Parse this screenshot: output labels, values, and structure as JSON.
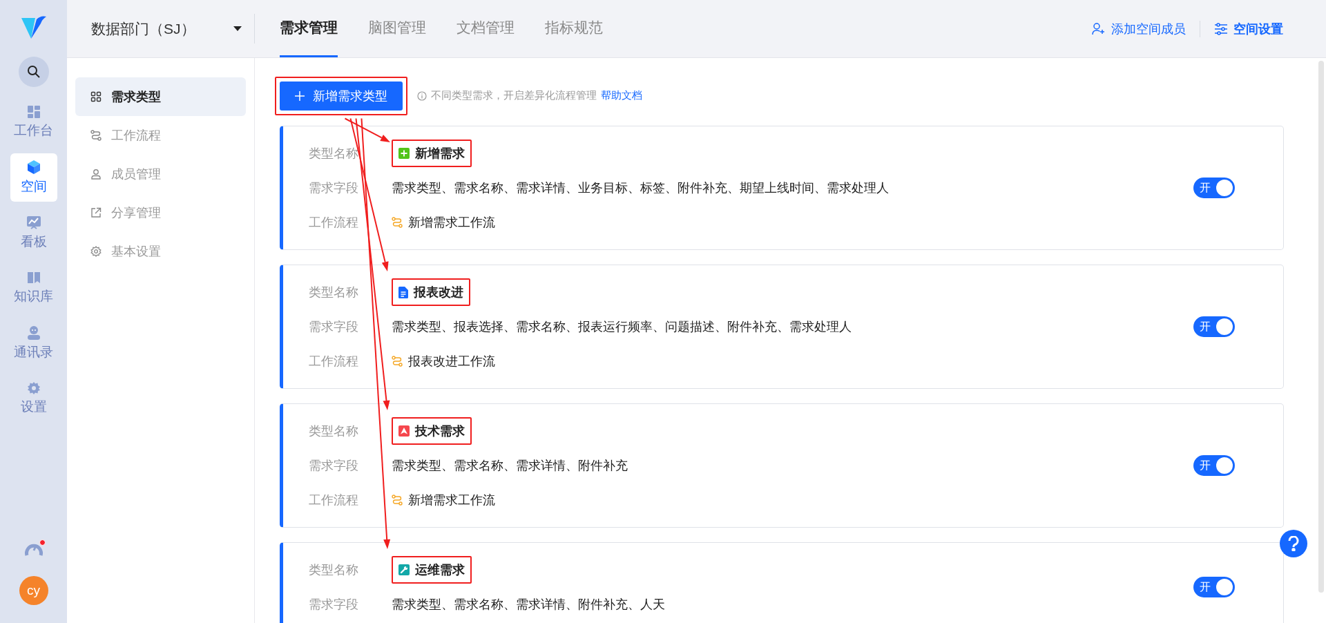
{
  "rail": {
    "items": [
      {
        "label": "工作台",
        "kind": "dashboard",
        "selected": false
      },
      {
        "label": "空间",
        "kind": "cube",
        "selected": true
      },
      {
        "label": "看板",
        "kind": "chart",
        "selected": false
      },
      {
        "label": "知识库",
        "kind": "book",
        "selected": false
      },
      {
        "label": "通讯录",
        "kind": "person",
        "selected": false
      },
      {
        "label": "设置",
        "kind": "gear",
        "selected": false
      }
    ],
    "notification": true,
    "avatar": "cy"
  },
  "org": {
    "name": "数据部门（SJ）"
  },
  "tabs": [
    {
      "label": "需求管理",
      "selected": true
    },
    {
      "label": "脑图管理",
      "selected": false
    },
    {
      "label": "文档管理",
      "selected": false
    },
    {
      "label": "指标规范",
      "selected": false
    }
  ],
  "actions": [
    {
      "label": "添加空间成员",
      "kind": "member"
    },
    {
      "label": "空间设置",
      "kind": "settings"
    }
  ],
  "sidebar": {
    "items": [
      {
        "label": "需求类型",
        "kind": "grid",
        "selected": true
      },
      {
        "label": "工作流程",
        "kind": "flow",
        "selected": false
      },
      {
        "label": "成员管理",
        "kind": "user",
        "selected": false
      },
      {
        "label": "分享管理",
        "kind": "share",
        "selected": false
      },
      {
        "label": "基本设置",
        "kind": "gear",
        "selected": false
      }
    ]
  },
  "toolbar": {
    "button": {
      "label": "新增需求类型",
      "highlighted": true
    },
    "hint": "不同类型需求，开启差异化流程管理",
    "help_link": "帮助文档"
  },
  "cards": [
    {
      "name_label": "类型名称",
      "name": "新增需求",
      "kind": "plus",
      "color": "#52c41a",
      "highlighted": true,
      "fields_label": "需求字段",
      "fields": "需求类型、需求名称、需求详情、业务目标、标签、附件补充、期望上线时间、需求处理人",
      "workflow_label": "工作流程",
      "workflow": "新增需求工作流",
      "on": true,
      "toggle_text": "开"
    },
    {
      "name_label": "类型名称",
      "name": "报表改进",
      "kind": "doc",
      "color": "#1668ff",
      "highlighted": true,
      "fields_label": "需求字段",
      "fields": "需求类型、报表选择、需求名称、报表运行频率、问题描述、附件补充、需求处理人",
      "workflow_label": "工作流程",
      "workflow": "报表改进工作流",
      "on": true,
      "toggle_text": "开"
    },
    {
      "name_label": "类型名称",
      "name": "技术需求",
      "kind": "alert",
      "color": "#f5474d",
      "highlighted": true,
      "fields_label": "需求字段",
      "fields": "需求类型、需求名称、需求详情、附件补充",
      "workflow_label": "工作流程",
      "workflow": "新增需求工作流",
      "on": true,
      "toggle_text": "开"
    },
    {
      "name_label": "类型名称",
      "name": "运维需求",
      "kind": "wrench",
      "color": "#13a8a8",
      "highlighted": true,
      "fields_label": "需求字段",
      "fields": "需求类型、需求名称、需求详情、附件补充、人天",
      "on": true,
      "toggle_text": "开"
    }
  ]
}
